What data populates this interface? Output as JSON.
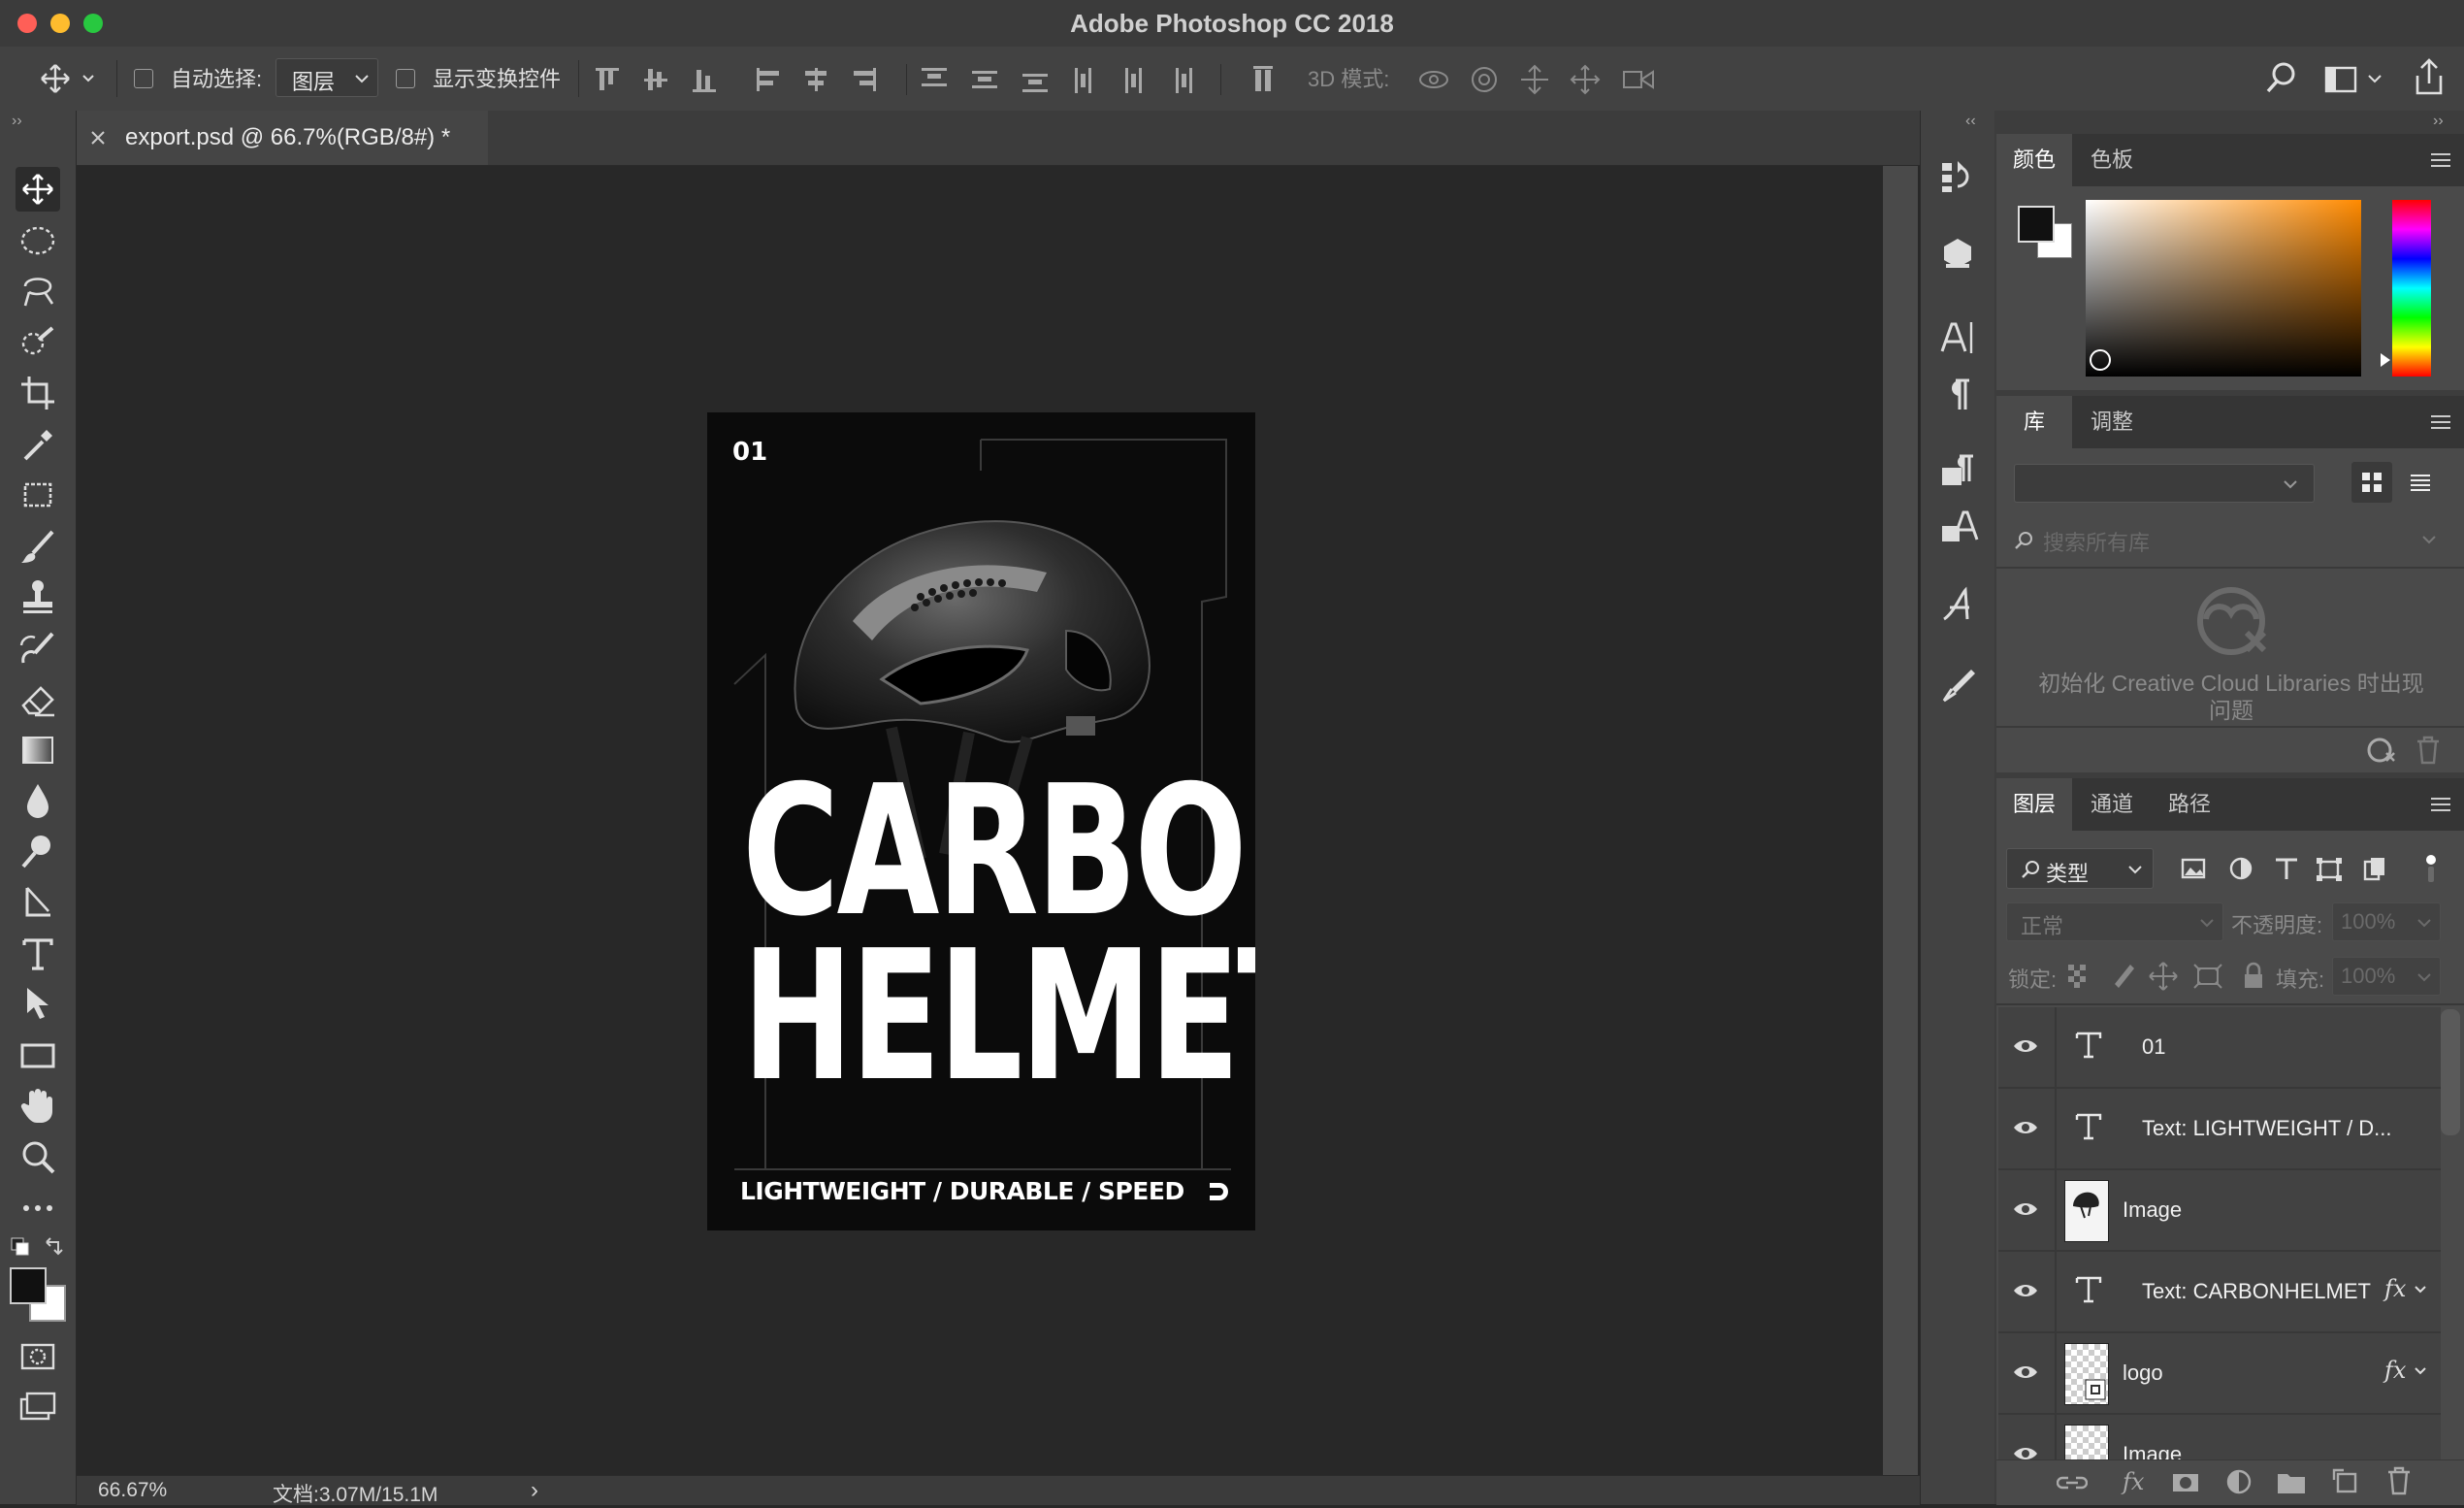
{
  "app_title": "Adobe Photoshop CC 2018",
  "options_bar": {
    "auto_select_label": "自动选择:",
    "auto_select_value": "图层",
    "show_transform_label": "显示变换控件",
    "mode_3d_label": "3D 模式:"
  },
  "document": {
    "tab_title": "export.psd @ 66.7%(RGB/8#) *",
    "zoom": "66.67%",
    "doc_size": "文档:3.07M/15.1M"
  },
  "poster": {
    "number": "01",
    "title_line1": "CARBON",
    "title_line2": "HELMET",
    "tagline": "LIGHTWEIGHT / DURABLE / SPEED"
  },
  "color_panel": {
    "tabs": [
      "颜色",
      "色板"
    ],
    "foreground": "#111111",
    "background": "#ffffff"
  },
  "library_panel": {
    "tabs": [
      "库",
      "调整"
    ],
    "search_placeholder": "搜索所有库",
    "error_message": "初始化 Creative Cloud Libraries 时出现问题"
  },
  "layers_panel": {
    "tabs": [
      "图层",
      "通道",
      "路径"
    ],
    "filter_label": "类型",
    "blend_mode": "正常",
    "opacity_label": "不透明度:",
    "opacity_value": "100%",
    "lock_label": "锁定:",
    "fill_label": "填充:",
    "fill_value": "100%",
    "layers": [
      {
        "name": "01",
        "kind": "text",
        "fx": false
      },
      {
        "name": "Text: LIGHTWEIGHT / D...",
        "kind": "text",
        "fx": false
      },
      {
        "name": "Image",
        "kind": "image",
        "fx": false
      },
      {
        "name": "Text: CARBONHELMET",
        "kind": "text",
        "fx": true
      },
      {
        "name": "logo",
        "kind": "smart",
        "fx": true
      },
      {
        "name": "Image",
        "kind": "image",
        "fx": false
      }
    ]
  },
  "fx_label": "fx"
}
